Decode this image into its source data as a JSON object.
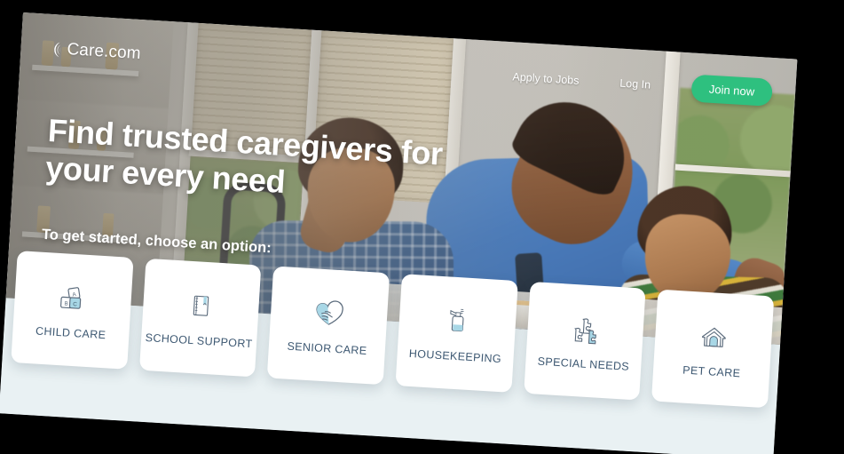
{
  "brand": {
    "name": "Care.com",
    "logo_icon": "care-crescent-icon",
    "accent_green": "#2ec07f",
    "text_slate": "#3c5771",
    "page_bg": "#e9f1f3"
  },
  "header": {
    "nav_links": [
      {
        "label": "Apply to Jobs",
        "name": "apply-to-jobs-link"
      },
      {
        "label": "Log In",
        "name": "log-in-link"
      }
    ],
    "cta": {
      "label": "Join now",
      "name": "join-now-button"
    }
  },
  "hero": {
    "headline": "Find trusted caregivers for your every need",
    "subhead": "To get started, choose an option:",
    "photo_alt": "Father kissing child at breakfast table with two boys"
  },
  "categories": [
    {
      "label": "CHILD CARE",
      "icon": "abc-blocks-icon"
    },
    {
      "label": "SCHOOL SUPPORT",
      "icon": "notebook-icon"
    },
    {
      "label": "SENIOR CARE",
      "icon": "heart-hands-icon"
    },
    {
      "label": "HOUSEKEEPING",
      "icon": "spray-bottle-icon"
    },
    {
      "label": "SPECIAL NEEDS",
      "icon": "puzzle-pieces-icon"
    },
    {
      "label": "PET CARE",
      "icon": "pet-house-icon"
    }
  ]
}
